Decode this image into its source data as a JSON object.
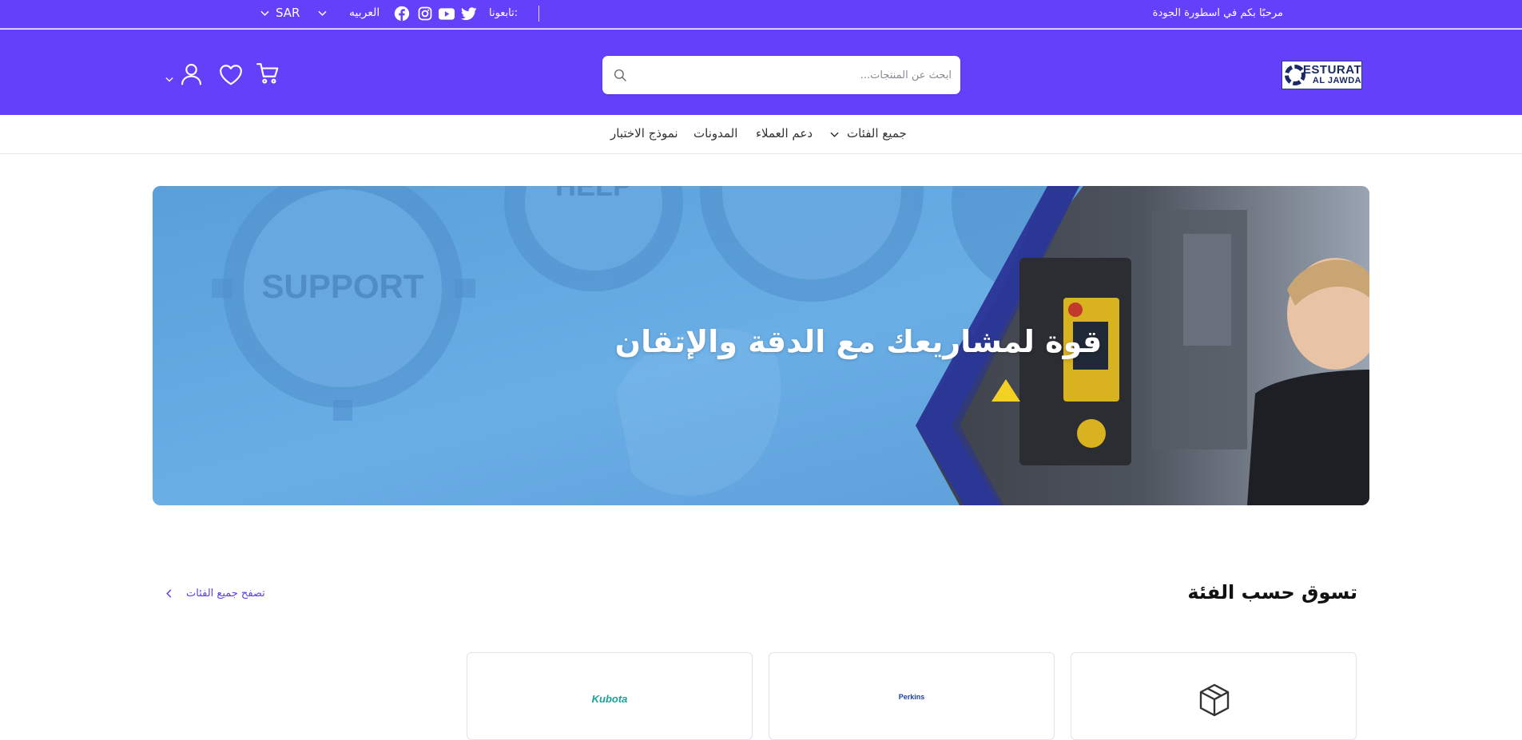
{
  "topbar": {
    "welcome": "مرحبًا بكم في اسطورة الجودة",
    "follow_label": "تابعونا:",
    "social": [
      "twitter-icon",
      "youtube-icon",
      "instagram-icon",
      "facebook-icon"
    ],
    "language": "العربيه",
    "currency": "SAR"
  },
  "header": {
    "logo_line1": "ESTURAT",
    "logo_line2": "AL JAWDA",
    "search_placeholder": "ابحث عن المنتجات...",
    "icons": [
      "cart-icon",
      "heart-icon",
      "user-icon",
      "chevron-down-icon"
    ]
  },
  "nav": {
    "items": [
      {
        "label": "جميع الفئات"
      },
      {
        "label": "دعم العملاء"
      },
      {
        "label": "المدونات"
      },
      {
        "label": "نموذج الاختبار"
      }
    ]
  },
  "hero": {
    "title": "قوة لمشاريعك مع الدقة والإتقان",
    "bg_text_support": "SUPPORT",
    "bg_text_help": "HELP"
  },
  "categories": {
    "title": "تسوق حسب الفئة",
    "browse_all": "تصفح جميع الفئات",
    "cards": [
      {
        "icon": "box-icon"
      },
      {
        "brand": "Perkins"
      },
      {
        "brand": "Kubota"
      }
    ]
  },
  "colors": {
    "primary": "#6440fa",
    "accent_link": "#5b3ef2",
    "hero_blue": "#5fa3dd",
    "hero_navy": "#2e3a9a"
  }
}
